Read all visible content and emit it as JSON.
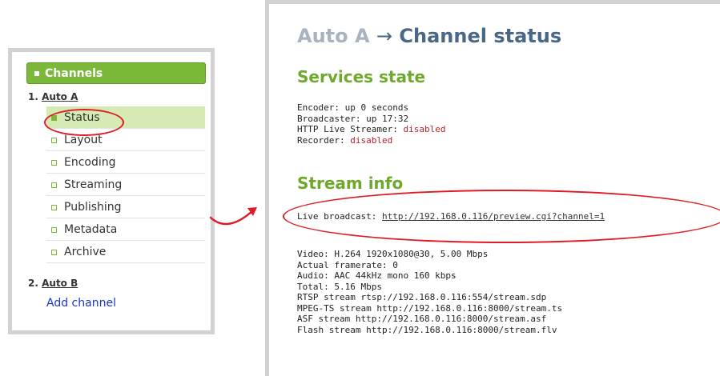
{
  "sidebar": {
    "header": "Channels",
    "channels": [
      {
        "number": "1.",
        "name": "Auto A"
      },
      {
        "number": "2.",
        "name": "Auto B"
      }
    ],
    "items": [
      {
        "label": "Status",
        "active": true
      },
      {
        "label": "Layout",
        "active": false
      },
      {
        "label": "Encoding",
        "active": false
      },
      {
        "label": "Streaming",
        "active": false
      },
      {
        "label": "Publishing",
        "active": false
      },
      {
        "label": "Metadata",
        "active": false
      },
      {
        "label": "Archive",
        "active": false
      }
    ],
    "add_channel": "Add channel"
  },
  "main": {
    "breadcrumb": "Auto A",
    "arrow": "→",
    "title": "Channel status",
    "services_heading": "Services state",
    "services": [
      {
        "label": "Encoder:",
        "value": "up 0 seconds",
        "status_color": ""
      },
      {
        "label": "Broadcaster:",
        "value": "up 17:32",
        "status_color": ""
      },
      {
        "label": "HTTP Live Streamer:",
        "value": "disabled",
        "status_color": "#b8222a"
      },
      {
        "label": "Recorder:",
        "value": "disabled",
        "status_color": "#b8222a"
      }
    ],
    "stream_heading": "Stream info",
    "live_broadcast_label": "Live broadcast:",
    "live_broadcast_url": "http://192.168.0.116/preview.cgi?channel=1",
    "stream_lines": [
      "Video: H.264 1920x1080@30, 5.00 Mbps",
      "Actual framerate: 0",
      "Audio: AAC 44kHz mono 160 kbps",
      "Total: 5.16 Mbps",
      "RTSP stream rtsp://192.168.0.116:554/stream.sdp",
      "MPEG-TS stream http://192.168.0.116:8000/stream.ts",
      "ASF stream http://192.168.0.116:8000/stream.asf",
      "Flash stream http://192.168.0.116:8000/stream.flv"
    ]
  },
  "colors": {
    "accent_green": "#7cb83a",
    "title_blue": "#4a6786",
    "disabled_red": "#b8222a",
    "highlight_red": "#e01b24"
  }
}
